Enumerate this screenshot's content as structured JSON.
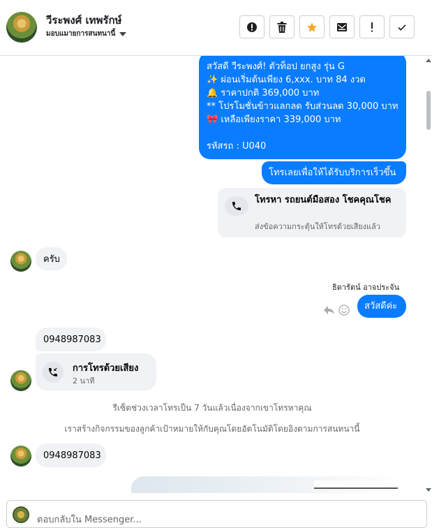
{
  "header": {
    "name": "วีระพงศ์ เทพรักษ์",
    "subtitle": "มอบแมายการสนทนานี้",
    "toolbar": [
      "alert-circle-icon",
      "trash-icon",
      "star-icon",
      "mark-unread-icon",
      "exclamation-icon",
      "check-icon"
    ],
    "colors": {
      "star": "#f5a623",
      "accent": "#0a7cff"
    }
  },
  "thread": {
    "promo_lines": [
      "สวัสดี วีระพงศ์! ตัวท็อป ยกสูง รุ่น G",
      "✨  ผ่อนเริ่มต้นเพียง 6,xxx. บาท 84 งวด",
      "🔔 ราคาปกติ 369,000 บาท",
      "** โปรโมชั่นข้าวแลกลด รับส่วนลด 30,000 บาท",
      "🎀  เหลือเพียงราคา 339,000 บาท",
      "",
      "รหัสรถ : U040"
    ],
    "call_prompt": "โทรเลยเพื่อให้ได้รับบริการเร็วขึ้น",
    "call_card": {
      "title": "โทรหา รถยนต์มือสอง โชคคุณโชค",
      "subtitle": "ส่งข้อความกระตุ้นให้โทรด้วยเสียงแล้ว"
    },
    "reply_krab": "ครับ",
    "agent_name": "ธิดารัตน์ อาจประจัน",
    "reply_sawasdee": "สวัสดีค่ะ",
    "phone_1": "0948987083",
    "voice_call": {
      "title": "การโทรด้วยเสียง",
      "duration": "2 นาที"
    },
    "note_1": "รีเซ็ตช่วงเวลาโทรเป็น 7 วันแล้วเนื่องจากเขาโทรหาคุณ",
    "note_2": "เราสร้างกิจกรรมของลูกค้าเป้าหมายให้กับคุณโดยอัตโนมัติโดยอิงตามการสนทนานี้",
    "phone_2": "0948987083"
  },
  "composer": {
    "placeholder": "ตอบกลับใน Messenger..."
  }
}
